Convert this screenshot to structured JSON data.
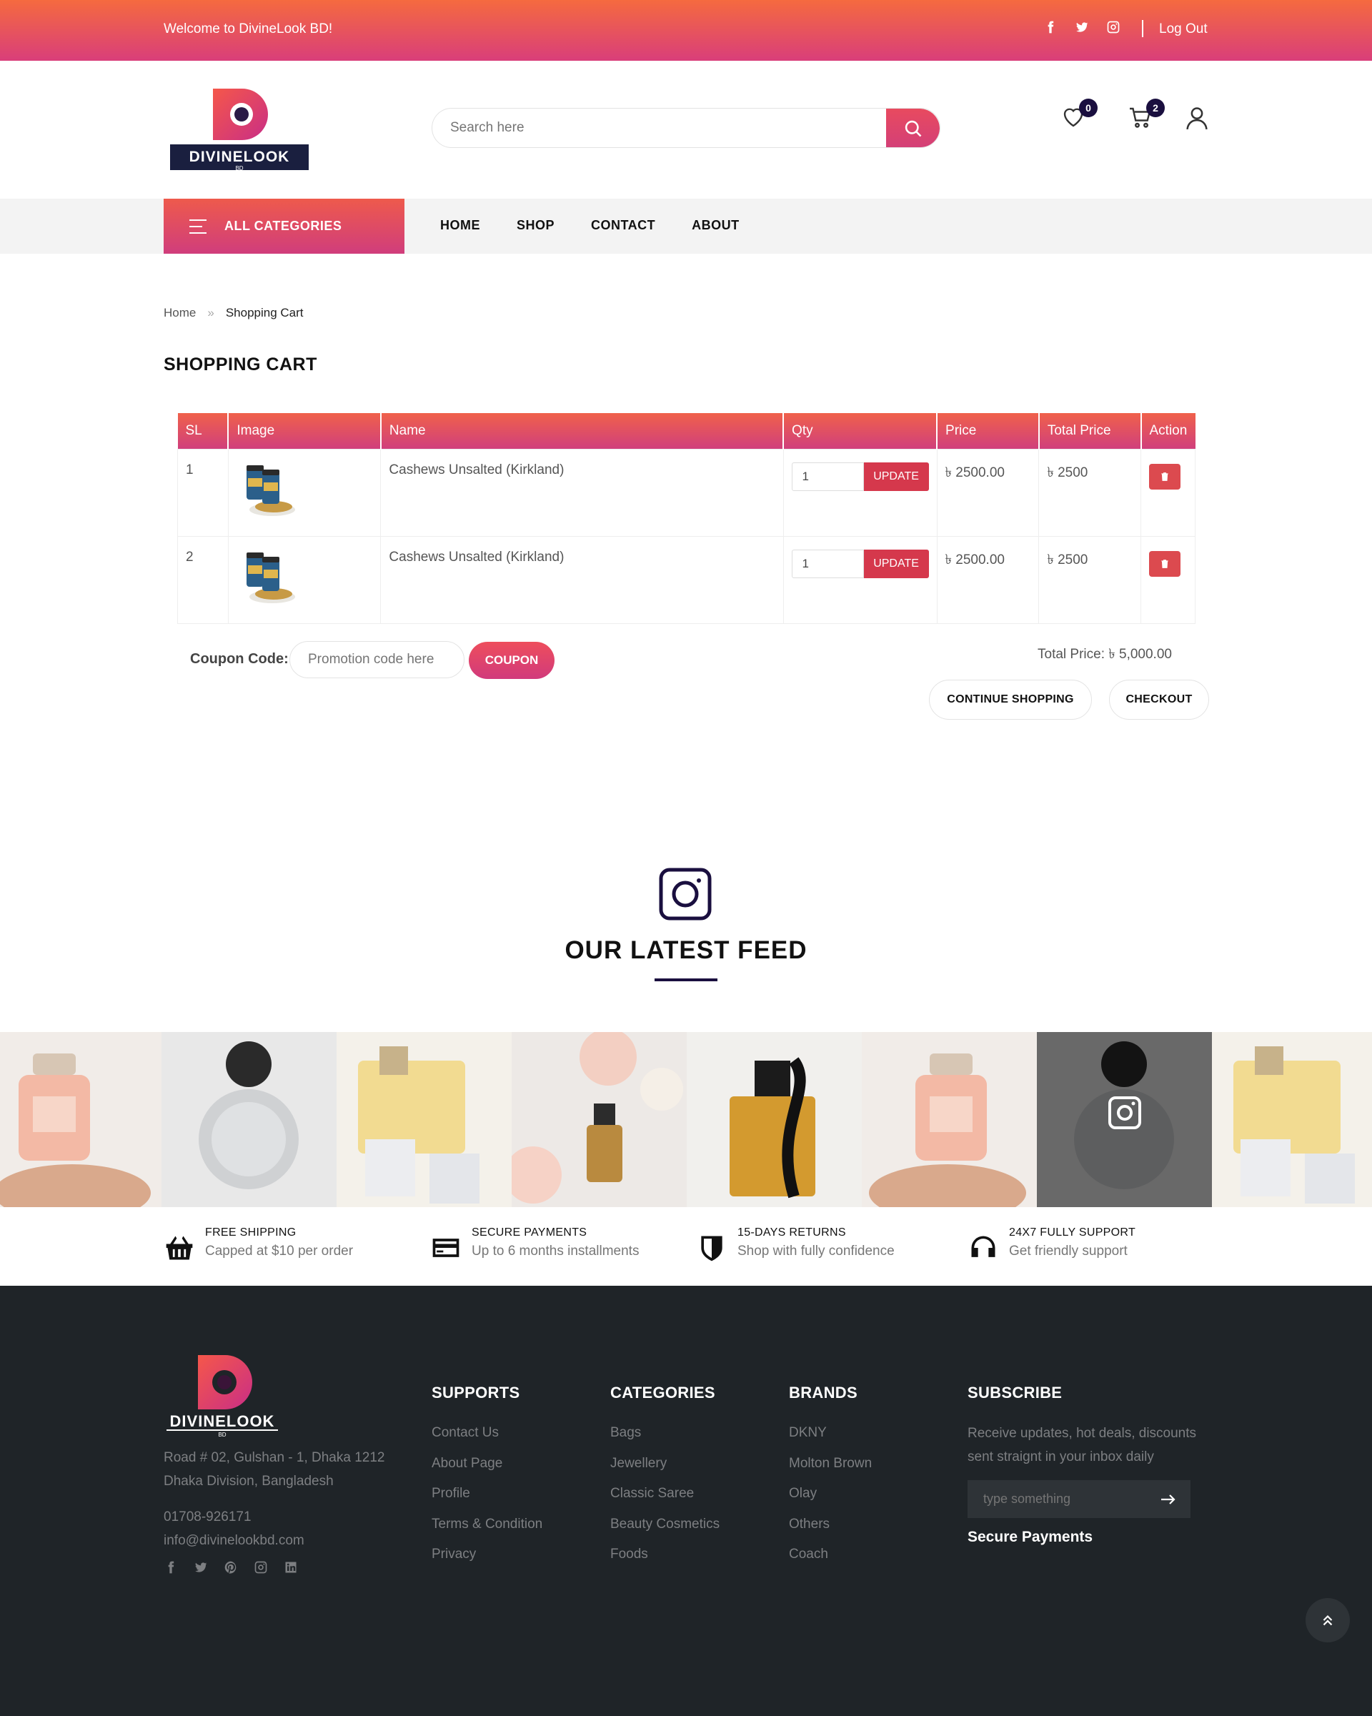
{
  "topbar": {
    "welcome": "Welcome to DivineLook BD!",
    "logout": "Log Out",
    "social_icons": [
      "facebook-icon",
      "twitter-icon",
      "instagram-icon"
    ]
  },
  "brand": {
    "name": "DIVINELOOK",
    "sub": "BD",
    "accent": "#d93e7a",
    "accent2": "#f56a3f",
    "navy": "#1a0f3f"
  },
  "header": {
    "search_placeholder": "Search here",
    "wishlist_count": "0",
    "cart_count": "2"
  },
  "nav": {
    "all_categories": "ALL CATEGORIES",
    "items": [
      "HOME",
      "SHOP",
      "CONTACT",
      "ABOUT"
    ]
  },
  "breadcrumb": {
    "home": "Home",
    "separator": "»",
    "current": "Shopping Cart"
  },
  "page_title": "SHOPPING CART",
  "cart": {
    "columns": [
      "SL",
      "Image",
      "Name",
      "Qty",
      "Price",
      "Total Price",
      "Action"
    ],
    "update_label": "UPDATE",
    "rows": [
      {
        "sl": "1",
        "name": "Cashews Unsalted (Kirkland)",
        "qty": "1",
        "price": "৳ 2500.00",
        "total": "৳ 2500"
      },
      {
        "sl": "2",
        "name": "Cashews Unsalted (Kirkland)",
        "qty": "1",
        "price": "৳ 2500.00",
        "total": "৳ 2500"
      }
    ],
    "coupon_label": "Coupon Code:",
    "coupon_placeholder": "Promotion code here",
    "coupon_button": "COUPON",
    "total_price": "Total Price: ৳ 5,000.00",
    "continue_shopping": "CONTINUE SHOPPING",
    "checkout": "CHECKOUT"
  },
  "feed": {
    "title": "OUR LATEST FEED"
  },
  "features": [
    {
      "icon": "basket-icon",
      "title": "FREE SHIPPING",
      "subtitle": "Capped at $10 per order"
    },
    {
      "icon": "credit-card-icon",
      "title": "SECURE PAYMENTS",
      "subtitle": "Up to 6 months installments"
    },
    {
      "icon": "shield-icon",
      "title": "15-DAYS RETURNS",
      "subtitle": "Shop with fully confidence"
    },
    {
      "icon": "headphones-icon",
      "title": "24X7 FULLY SUPPORT",
      "subtitle": "Get friendly support"
    }
  ],
  "footer": {
    "address_line1": "Road # 02, Gulshan - 1, Dhaka 1212",
    "address_line2": "Dhaka Division, Bangladesh",
    "phone": "01708-926171",
    "email": "info@divinelookbd.com",
    "columns": [
      {
        "title": "SUPPORTS",
        "items": [
          "Contact Us",
          "About Page",
          "Profile",
          "Terms & Condition",
          "Privacy"
        ]
      },
      {
        "title": "CATEGORIES",
        "items": [
          "Bags",
          "Jewellery",
          "Classic Saree",
          "Beauty Cosmetics",
          "Foods"
        ]
      },
      {
        "title": "BRANDS",
        "items": [
          "DKNY",
          "Molton Brown",
          "Olay",
          "Others",
          "Coach"
        ]
      }
    ],
    "subscribe": {
      "title": "SUBSCRIBE",
      "description": "Receive updates, hot deals, discounts sent straignt in your inbox daily",
      "placeholder": "type something",
      "secure_payments": "Secure Payments"
    }
  }
}
